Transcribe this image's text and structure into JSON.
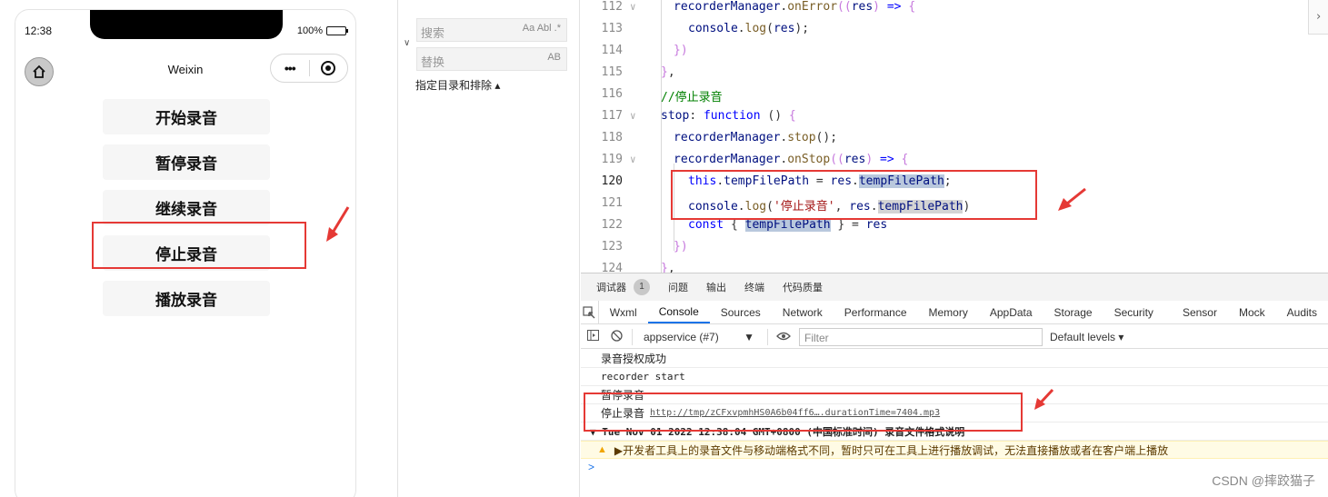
{
  "phone": {
    "status_time": "12:38",
    "battery": "100%",
    "battery_level": 1.0,
    "nav_title": "Weixin",
    "buttons": [
      "开始录音",
      "暂停录音",
      "继续录音",
      "停止录音",
      "播放录音"
    ]
  },
  "search_panel": {
    "search_placeholder": "搜索",
    "search_opts": "Aa  Abl  .*",
    "replace_placeholder": "替换",
    "replace_opts": "AB",
    "filter_label": "指定目录和排除 ▴"
  },
  "editor": {
    "lines": [
      {
        "num": "112",
        "code": "recorderManager.onError((res) => {"
      },
      {
        "num": "113",
        "code": "console.log(res);"
      },
      {
        "num": "114",
        "code": "})"
      },
      {
        "num": "115",
        "code": "},"
      },
      {
        "num": "116",
        "code": "//停止录音"
      },
      {
        "num": "117",
        "code": "stop: function () {"
      },
      {
        "num": "118",
        "code": "recorderManager.stop();"
      },
      {
        "num": "119",
        "code": "recorderManager.onStop((res) => {"
      },
      {
        "num": "120",
        "code": "this.tempFilePath = res.tempFilePath;"
      },
      {
        "num": "121",
        "code": "console.log('停止录音', res.tempFilePath)"
      },
      {
        "num": "122",
        "code": "const { tempFilePath } = res"
      },
      {
        "num": "123",
        "code": "})"
      },
      {
        "num": "124",
        "code": "},"
      }
    ]
  },
  "debug": {
    "top_tabs": [
      "调试器",
      "问题",
      "输出",
      "终端",
      "代码质量"
    ],
    "badge": "1",
    "sub_tabs": [
      "Wxml",
      "Console",
      "Sources",
      "Network",
      "Performance",
      "Memory",
      "AppData",
      "Storage",
      "Security",
      "Sensor",
      "Mock",
      "Audits"
    ],
    "active_tab": "Console",
    "context": "appservice (#7)",
    "filter_placeholder": "Filter",
    "levels": "Default levels ▾",
    "console_lines": [
      "录音授权成功",
      "recorder start",
      "暂停录音"
    ],
    "stop_msg": "停止录音",
    "stop_link": "http://tmp/zCFxvpmhHS0A6b04ff6….durationTime=7404.mp3",
    "group_msg": "▼ Tue Nov 01 2022 12:38:04 GMT+0800 (中国标准时间) 录音文件格式说明",
    "warn_msg": "▶开发者工具上的录音文件与移动端格式不同，暂时只可在工具上进行播放调试，无法直接播放或者在客户端上播放",
    "prompt": ">"
  },
  "watermark": "CSDN @摔跤猫子",
  "colors": {
    "annotation_red": "#e53935",
    "accent_blue": "#1a73e8"
  }
}
